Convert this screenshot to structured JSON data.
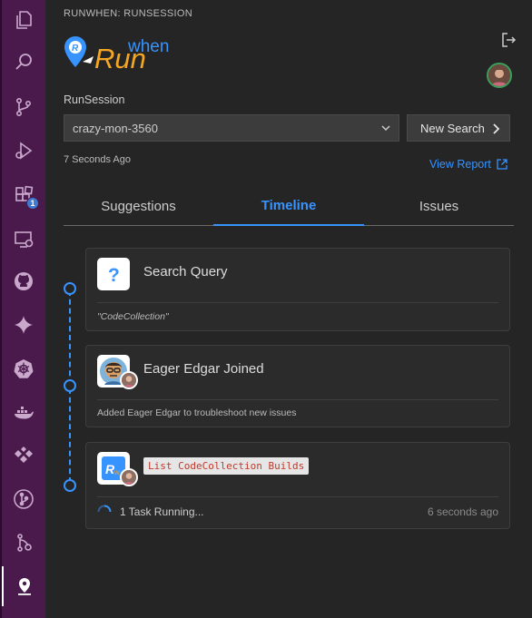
{
  "activity_bar": {
    "items": [
      {
        "name": "explorer-icon"
      },
      {
        "name": "search-icon"
      },
      {
        "name": "source-control-icon"
      },
      {
        "name": "run-debug-icon"
      },
      {
        "name": "extensions-icon",
        "badge": "1"
      },
      {
        "name": "remote-explorer-icon"
      },
      {
        "name": "github-icon"
      },
      {
        "name": "sparkle-icon"
      },
      {
        "name": "kubernetes-icon"
      },
      {
        "name": "docker-icon"
      },
      {
        "name": "puzzle-blocks-icon"
      },
      {
        "name": "git-graph-icon"
      },
      {
        "name": "gitlens-icon"
      },
      {
        "name": "runwhen-icon"
      }
    ],
    "active": "runwhen-icon",
    "colors": {
      "background": "#4a1a4d",
      "active_indicator": "#ffffff"
    }
  },
  "panel": {
    "title": "RUNWHEN: RUNSESSION",
    "logo": {
      "text_primary": "Run",
      "text_secondary": "when",
      "colors": {
        "run": "#f5a623",
        "when": "#3794ff"
      }
    },
    "runsession_label": "RunSession",
    "session_select": {
      "value": "crazy-mon-3560"
    },
    "new_search_label": "New Search",
    "updated_ago": "7 Seconds Ago",
    "view_report_label": "View Report",
    "tabs": [
      {
        "label": "Suggestions",
        "active": false
      },
      {
        "label": "Timeline",
        "active": true
      },
      {
        "label": "Issues",
        "active": false
      }
    ],
    "accent_color": "#3794ff"
  },
  "timeline": [
    {
      "icon": "question-icon",
      "title": "Search Query",
      "footer": "\"CodeCollection\""
    },
    {
      "icon": "eager-edgar-avatar",
      "title": "Eager Edgar Joined",
      "footer": "Added Eager Edgar to troubleshoot new issues"
    },
    {
      "icon": "runwhen-logo-icon",
      "command": "List CodeCollection Builds",
      "status": "1 Task Running...",
      "ago": "6 seconds ago"
    }
  ]
}
